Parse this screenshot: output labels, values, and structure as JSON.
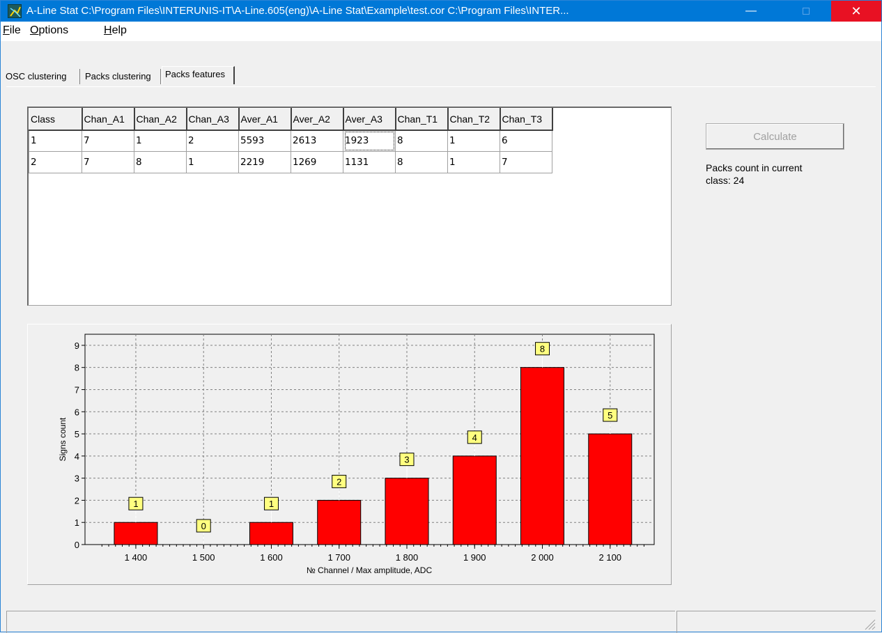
{
  "window": {
    "title": "A-Line Stat   C:\\Program Files\\INTERUNIS-IT\\A-Line.605(eng)\\A-Line Stat\\Example\\test.cor   C:\\Program Files\\INTER...",
    "minimize_glyph": "—",
    "close_glyph": "✕"
  },
  "menu": [
    {
      "label": "File",
      "accel": "F",
      "rest": "ile"
    },
    {
      "label": "Options",
      "accel": "O",
      "rest": "ptions"
    },
    {
      "label": "Help",
      "accel": "H",
      "rest": "elp"
    }
  ],
  "tabs": [
    {
      "label": "OSC clustering",
      "active": false
    },
    {
      "label": "Packs clustering",
      "active": false
    },
    {
      "label": "Packs features",
      "active": true
    }
  ],
  "grid": {
    "columns": [
      "Class",
      "Chan_A1",
      "Chan_A2",
      "Chan_A3",
      "Aver_A1",
      "Aver_A2",
      "Aver_A3",
      "Chan_T1",
      "Chan_T2",
      "Chan_T3"
    ],
    "rows": [
      [
        "1",
        "7",
        "1",
        "2",
        "5593",
        "2613",
        "1923",
        "8",
        "1",
        "6"
      ],
      [
        "2",
        "7",
        "8",
        "1",
        "2219",
        "1269",
        "1131",
        "8",
        "1",
        "7"
      ]
    ]
  },
  "calculate_button": {
    "label": "Calculate",
    "enabled": false
  },
  "packs_count": {
    "line1": "Packs count in current",
    "line2": "class: 24"
  },
  "chart_data": {
    "type": "bar",
    "categories": [
      "1 400",
      "1 500",
      "1 600",
      "1 700",
      "1 800",
      "1 900",
      "2 000",
      "2 100"
    ],
    "x": [
      1400,
      1500,
      1600,
      1700,
      1800,
      1900,
      2000,
      2100
    ],
    "values": [
      1,
      0,
      1,
      2,
      3,
      4,
      8,
      5
    ],
    "xlabel": "№ Channel / Max amplitude, ADC",
    "ylabel": "Signs count",
    "yticks": [
      0,
      1,
      2,
      3,
      4,
      5,
      6,
      7,
      8,
      9
    ],
    "ylim": [
      0,
      9.5
    ],
    "xlim": [
      1325,
      2165
    ],
    "grid": true,
    "bar_color": "#ff0000",
    "label_bg": "#ffff80"
  }
}
